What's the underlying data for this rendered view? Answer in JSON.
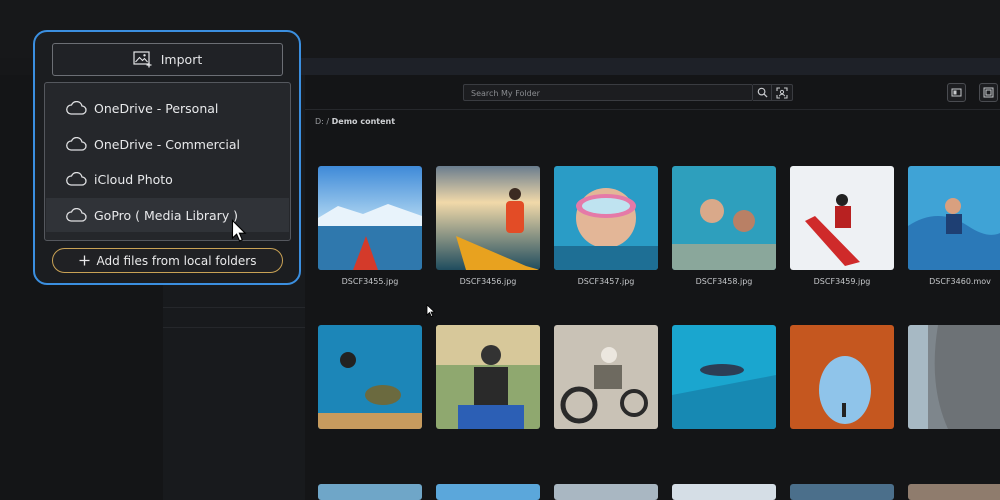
{
  "import_menu": {
    "import_label": "Import",
    "sources": [
      {
        "label": "OneDrive - Personal",
        "icon": "cloud-icon"
      },
      {
        "label": "OneDrive - Commercial",
        "icon": "cloud-icon"
      },
      {
        "label": "iCloud Photo",
        "icon": "cloud-icon"
      },
      {
        "label": "GoPro ( Media Library )",
        "icon": "cloud-icon"
      }
    ],
    "hovered_index": 3,
    "add_files_label": "Add files from local folders",
    "accent_color": "#3b8fe0",
    "add_files_border_color": "#c9a255"
  },
  "search": {
    "placeholder": "Search My Folder"
  },
  "breadcrumb": {
    "root": "D: /",
    "current": "Demo content"
  },
  "gallery": {
    "row1": [
      {
        "name": "DSCF3455.jpg"
      },
      {
        "name": "DSCF3456.jpg"
      },
      {
        "name": "DSCF3457.jpg"
      },
      {
        "name": "DSCF3458.jpg"
      },
      {
        "name": "DSCF3459.jpg"
      },
      {
        "name": "DSCF3460.mov"
      }
    ]
  }
}
